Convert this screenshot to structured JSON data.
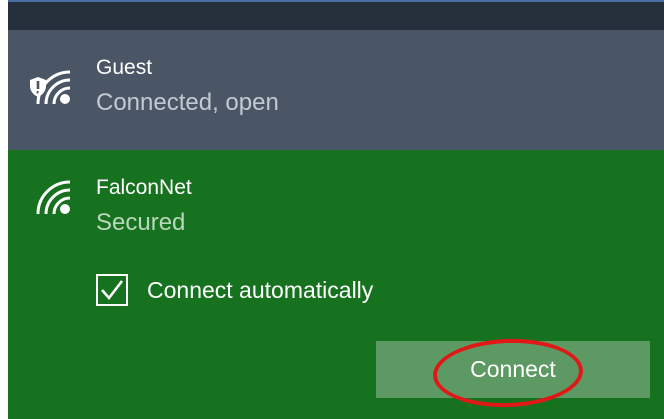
{
  "networks": [
    {
      "name": "Guest",
      "status": "Connected, open",
      "icon": "wifi-icon",
      "badge_icon": "shield-exclamation-icon"
    },
    {
      "name": "FalconNet",
      "status": "Secured",
      "icon": "wifi-icon"
    }
  ],
  "connect_automatically": {
    "label": "Connect automatically",
    "checked": true
  },
  "connect_button": {
    "label": "Connect"
  },
  "colors": {
    "guest_background": "#4a5566",
    "selected_background": "#17721f",
    "button_background": "#5d9962",
    "highlight_ring": "#e11818"
  }
}
